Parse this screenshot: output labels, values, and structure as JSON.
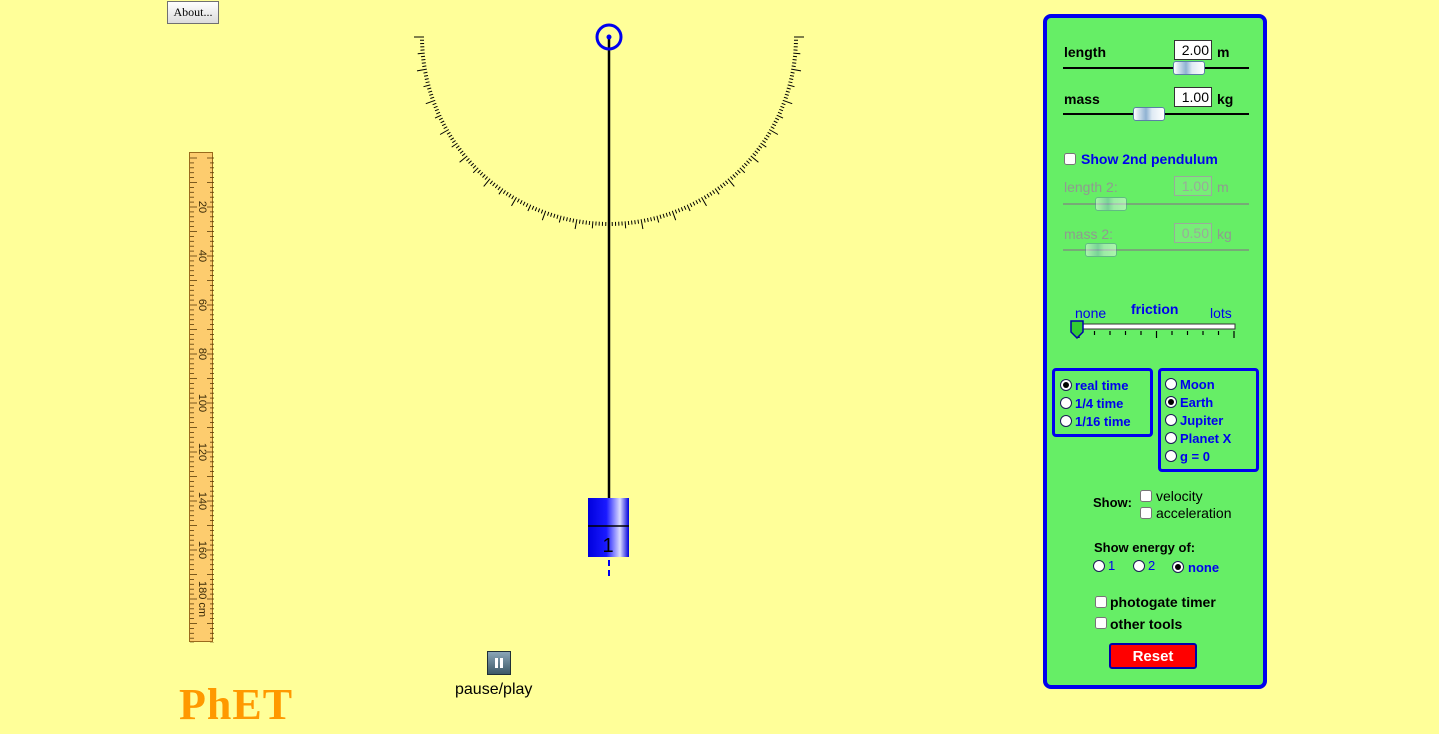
{
  "header": {
    "about_label": "About..."
  },
  "ruler": {
    "labels": [
      "20",
      "40",
      "60",
      "80",
      "100",
      "120",
      "140",
      "160",
      "180 cm"
    ]
  },
  "pendulum": {
    "bob_label": "1"
  },
  "playback": {
    "pause_play_label": "pause/play"
  },
  "logo": {
    "text": "PhET"
  },
  "panel": {
    "length": {
      "label": "length",
      "value": "2.00",
      "unit": "m"
    },
    "mass": {
      "label": "mass",
      "value": "1.00",
      "unit": "kg"
    },
    "second_pendulum": {
      "label": "Show 2nd pendulum"
    },
    "length2": {
      "label": "length 2:",
      "value": "1.00",
      "unit": "m"
    },
    "mass2": {
      "label": "mass 2:",
      "value": "0.50",
      "unit": "kg"
    },
    "friction": {
      "title": "friction",
      "min_label": "none",
      "max_label": "lots"
    },
    "time_options": [
      {
        "label": "real time",
        "selected": true
      },
      {
        "label": "1/4 time",
        "selected": false
      },
      {
        "label": "1/16 time",
        "selected": false
      }
    ],
    "gravity_options": [
      {
        "label": "Moon",
        "selected": false
      },
      {
        "label": "Earth",
        "selected": true
      },
      {
        "label": "Jupiter",
        "selected": false
      },
      {
        "label": "Planet X",
        "selected": false
      },
      {
        "label": "g = 0",
        "selected": false
      }
    ],
    "show": {
      "label": "Show:",
      "velocity": "velocity",
      "acceleration": "acceleration"
    },
    "energy": {
      "label": "Show energy of:",
      "opt1": "1",
      "opt2": "2",
      "opt_none": "none"
    },
    "photogate_label": "photogate timer",
    "other_tools_label": "other tools",
    "reset_label": "Reset"
  },
  "colors": {
    "background": "#ffff99",
    "panel_bg": "#66ee66",
    "panel_border": "#0000ee",
    "bob": "#0000ee",
    "reset": "#ff0000",
    "logo": "#ff9900"
  }
}
